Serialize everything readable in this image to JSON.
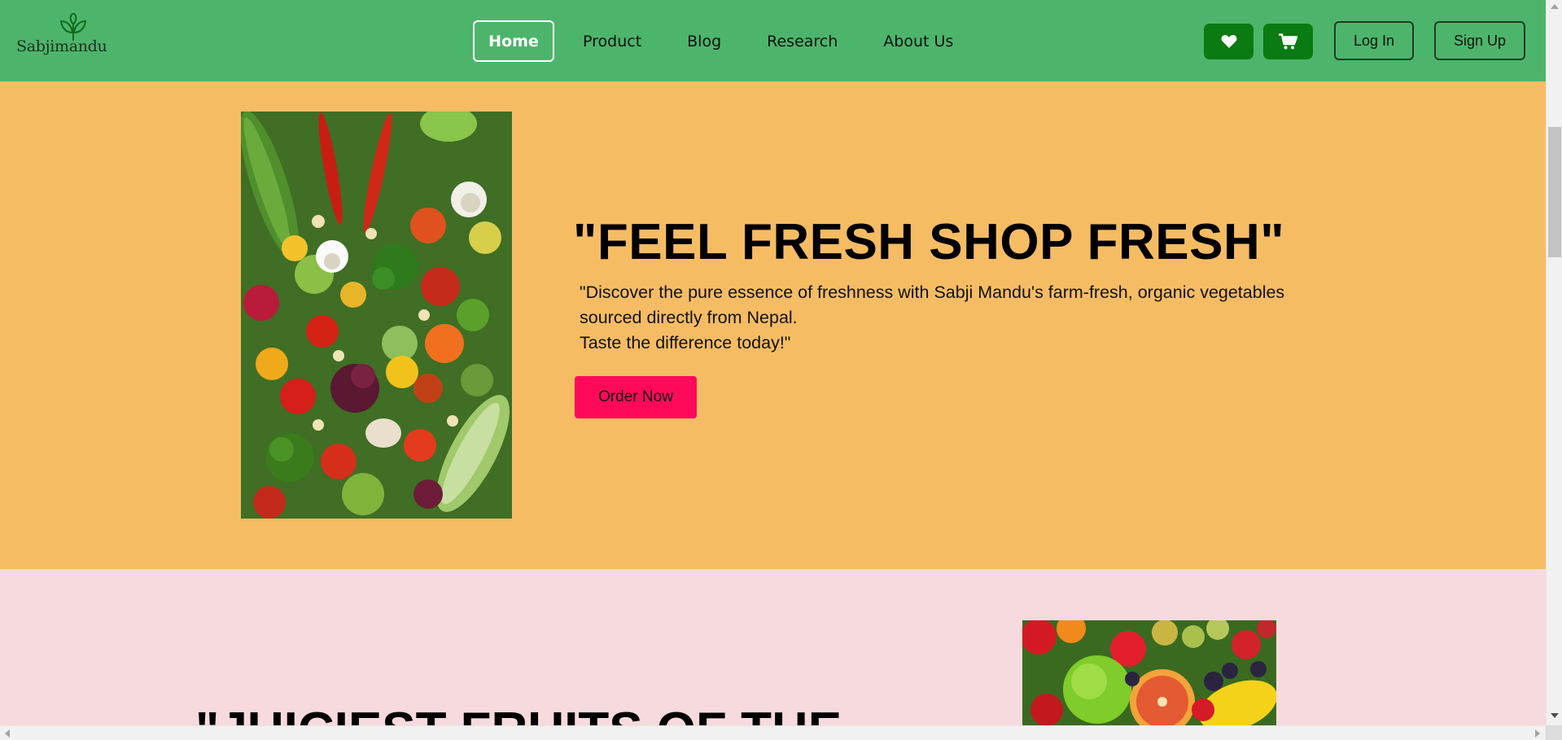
{
  "brand": {
    "logo_text": "Sabjimandu",
    "logo_icon": "leaf-sprout-icon"
  },
  "nav": {
    "links": [
      {
        "label": "Home",
        "active": true
      },
      {
        "label": "Product",
        "active": false
      },
      {
        "label": "Blog",
        "active": false
      },
      {
        "label": "Research",
        "active": false
      },
      {
        "label": "About Us",
        "active": false
      }
    ],
    "wishlist_icon": "heart-icon",
    "cart_icon": "shopping-cart-icon",
    "login_label": "Log In",
    "signup_label": "Sign Up"
  },
  "hero": {
    "title": "\"FEEL FRESH SHOP FRESH\"",
    "description_lines": [
      "\"Discover the pure essence of freshness with Sabji Mandu's farm-fresh, organic vegetables",
      "sourced directly from Nepal.",
      "Taste the difference today!\""
    ],
    "cta_label": "Order Now"
  },
  "section2": {
    "title_partial": "\"JUICIEST FRUITS OF THE"
  },
  "colors": {
    "navbar_bg": "#4db56b",
    "hero_bg": "#f6bc64",
    "section2_bg": "#f7dadd",
    "icon_button_bg": "#0a7a12",
    "cta_bg": "#ff0a5a"
  }
}
